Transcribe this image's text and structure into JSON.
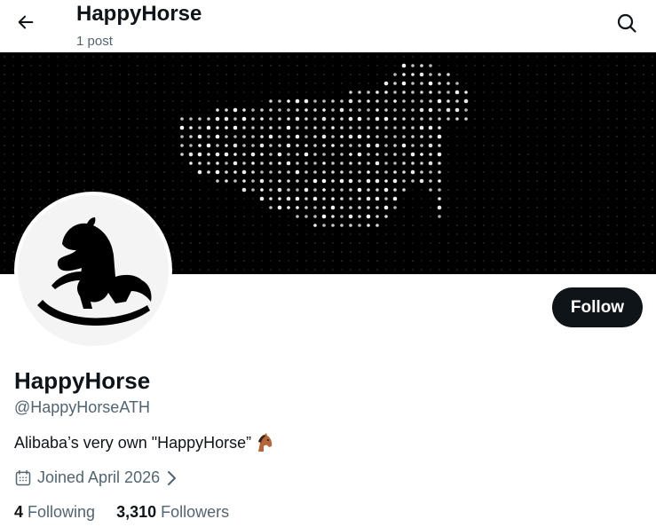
{
  "header": {
    "title": "HappyHorse",
    "post_count": "1 post"
  },
  "profile": {
    "display_name": "HappyHorse",
    "handle": "@HappyHorseATH",
    "bio": "Alibaba’s very own \"HappyHorse”",
    "joined": "Joined April 2026",
    "follow_label": "Follow",
    "following_count": "4",
    "following_label": "Following",
    "followers_count": "3,310",
    "followers_label": "Followers"
  },
  "icons": {
    "back": "arrow-left-icon",
    "search": "search-icon",
    "calendar": "calendar-icon",
    "chevron": "chevron-right-icon",
    "bio_emoji": "horse-face-emoji"
  },
  "colors": {
    "text": "#0f1419",
    "muted": "#536471",
    "banner_bg": "#000000",
    "button_bg": "#0f1419",
    "emoji_horse": "#b4663a"
  }
}
